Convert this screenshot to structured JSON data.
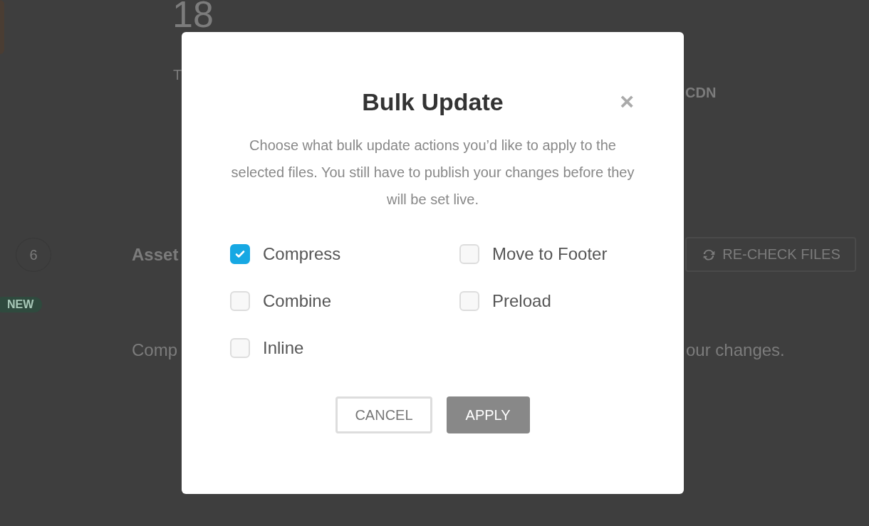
{
  "background": {
    "stat_value": "18",
    "stat_label": "T",
    "column_heading": "CDN",
    "count_badge": "6",
    "section_title": "Asset",
    "new_tag": "NEW",
    "notice_start": "Comp",
    "notice_end": "our changes.",
    "recheck_button": "RE-CHECK FILES"
  },
  "modal": {
    "title": "Bulk Update",
    "close": "×",
    "description": "Choose what bulk update actions you’d like to apply to the selected files. You still have to publish your changes before they will be set live.",
    "columns": [
      [
        {
          "label": "Compress",
          "checked": true
        },
        {
          "label": "Combine",
          "checked": false
        },
        {
          "label": "Inline",
          "checked": false
        }
      ],
      [
        {
          "label": "Move to Footer",
          "checked": false
        },
        {
          "label": "Preload",
          "checked": false
        }
      ]
    ],
    "buttons": [
      {
        "label": "CANCEL",
        "kind": "secondary"
      },
      {
        "label": "APPLY",
        "kind": "primary"
      }
    ]
  }
}
